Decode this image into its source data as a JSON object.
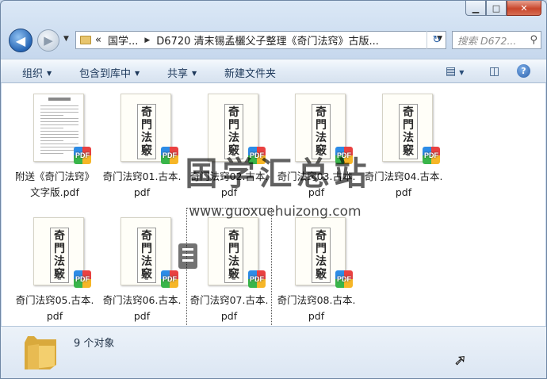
{
  "window": {
    "caption_buttons": {
      "minimize": "▁",
      "maximize": "□",
      "close": "✕"
    }
  },
  "navigation": {
    "back_glyph": "◀",
    "forward_glyph": "▶",
    "dropdown_glyph": "▼"
  },
  "address_bar": {
    "overflow": "«",
    "parts": [
      "国学...",
      "D6720 清末锡孟欐父子整理《奇门法窍》古版..."
    ],
    "separator": "▶",
    "dropdown_glyph": "▼",
    "refresh_glyph": "↻"
  },
  "search": {
    "placeholder": "搜索 D672...",
    "icon": "search-icon",
    "glyph": "⚲"
  },
  "toolbar": {
    "organize": "组织",
    "include_in_library": "包含到库中",
    "share": "共享",
    "new_folder": "新建文件夹",
    "dropdown_glyph": "▼",
    "view_glyph": "▤",
    "preview_pane_glyph": "◫",
    "help_glyph": "?"
  },
  "files": [
    {
      "name": "附送《奇门法窍》文字版.pdf",
      "line1": "附送《奇门法窍》",
      "line2": "文字版.pdf",
      "thumb": "text-document",
      "badge": "PDF"
    },
    {
      "name": "奇门法窍01.古本.pdf",
      "line1": "奇门法窍01.古本.",
      "line2": "pdf",
      "thumb": "book-cover",
      "badge": "PDF"
    },
    {
      "name": "奇门法窍02.古本.pdf",
      "line1": "奇门法窍02.古本.",
      "line2": "pdf",
      "thumb": "book-cover",
      "badge": "PDF"
    },
    {
      "name": "奇门法窍03.古本.pdf",
      "line1": "奇门法窍03.古本.",
      "line2": "pdf",
      "thumb": "book-cover",
      "badge": "PDF"
    },
    {
      "name": "奇门法窍04.古本.pdf",
      "line1": "奇门法窍04.古本.",
      "line2": "pdf",
      "thumb": "book-cover",
      "badge": "PDF"
    },
    {
      "name": "奇门法窍05.古本.pdf",
      "line1": "奇门法窍05.古本.",
      "line2": "pdf",
      "thumb": "book-cover",
      "badge": "PDF"
    },
    {
      "name": "奇门法窍06.古本.pdf",
      "line1": "奇门法窍06.古本.",
      "line2": "pdf",
      "thumb": "book-cover",
      "badge": "PDF"
    },
    {
      "name": "奇门法窍07.古本.pdf",
      "line1": "奇门法窍07.古本.",
      "line2": "pdf",
      "thumb": "book-cover",
      "badge": "PDF",
      "focused": true
    },
    {
      "name": "奇门法窍08.古本.pdf",
      "line1": "奇门法窍08.古本.",
      "line2": "pdf",
      "thumb": "book-cover",
      "badge": "PDF"
    }
  ],
  "thumbnail_text": {
    "cover_vertical": "奇\n門\n法\n竅"
  },
  "watermark": {
    "title": "国学汇总站",
    "url": "www.guoxuehuizong.com"
  },
  "details_pane": {
    "item_count": "9 个对象"
  },
  "colors": {
    "accent": "#2766b5",
    "close_button": "#c9462c",
    "folder": "#e8c56d"
  }
}
